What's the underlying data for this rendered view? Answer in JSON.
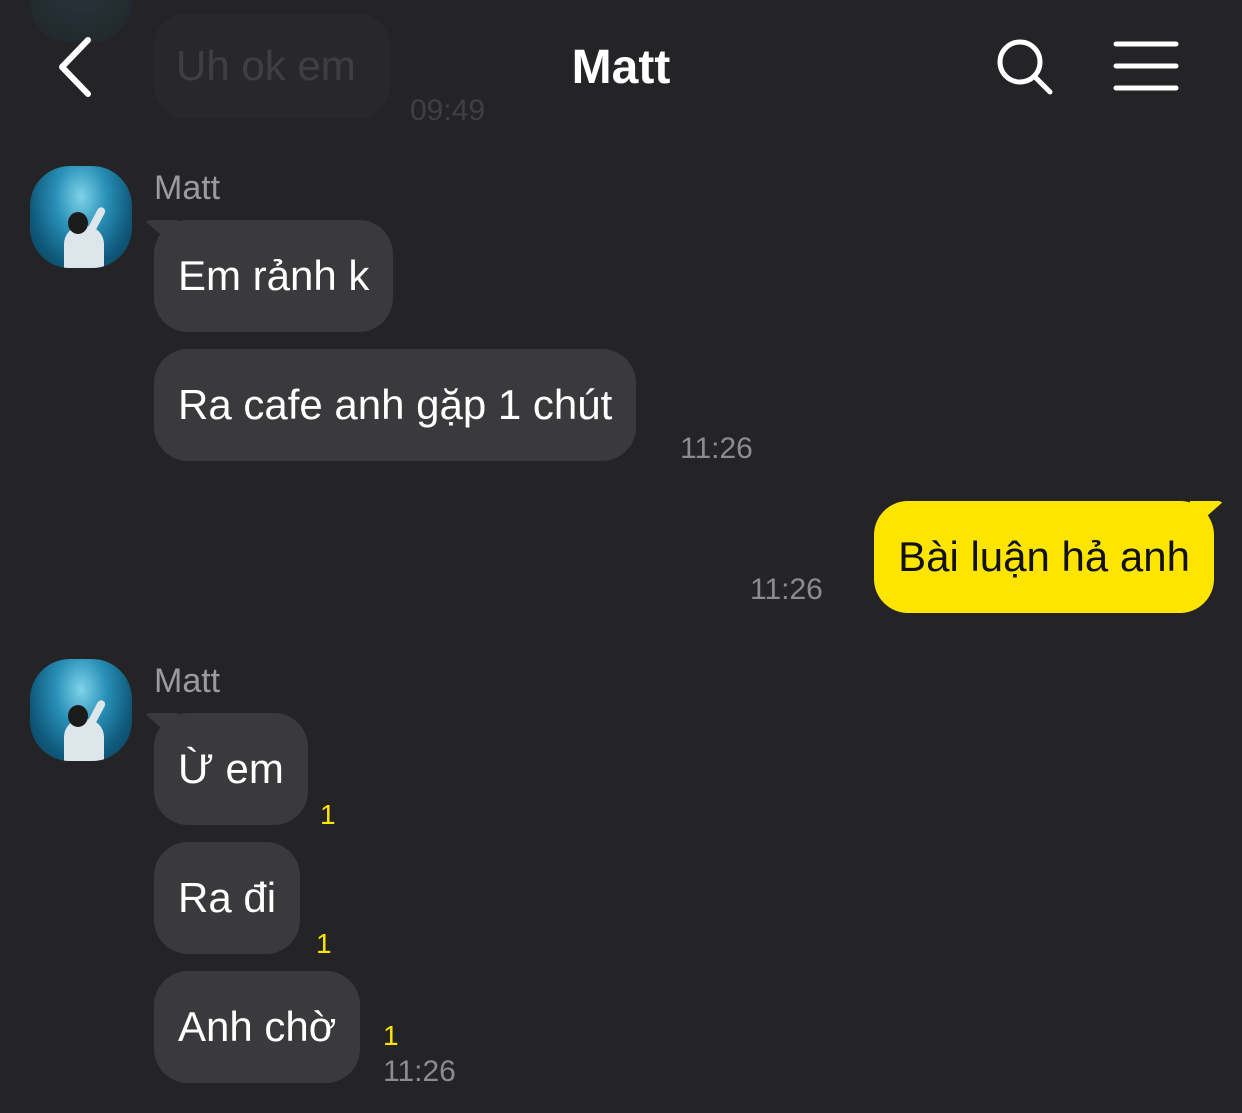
{
  "header": {
    "title": "Matt",
    "back_icon": "chevron-left-icon",
    "search_icon": "search-icon",
    "menu_icon": "hamburger-menu-icon"
  },
  "previous_message": {
    "text": "Uh ok em",
    "time": "09:49"
  },
  "groups": [
    {
      "sender": "Matt",
      "messages": [
        {
          "text": "Em rảnh k",
          "unread": "",
          "time": ""
        },
        {
          "text": "Ra cafe anh gặp 1 chút",
          "unread": "",
          "time": "11:26"
        }
      ]
    },
    {
      "sender": "me",
      "messages": [
        {
          "text": "Bài luận hả anh",
          "unread": "",
          "time": "11:26"
        }
      ]
    },
    {
      "sender": "Matt",
      "messages": [
        {
          "text": "Ừ em",
          "unread": "1",
          "time": ""
        },
        {
          "text": "Ra đi",
          "unread": "1",
          "time": ""
        },
        {
          "text": "Anh chờ",
          "unread": "1",
          "time": "11:26"
        }
      ]
    }
  ],
  "colors": {
    "background": "#242426",
    "incoming_bubble": "#3a3a3c",
    "outgoing_bubble": "#fee500",
    "unread_count": "#fee500"
  }
}
